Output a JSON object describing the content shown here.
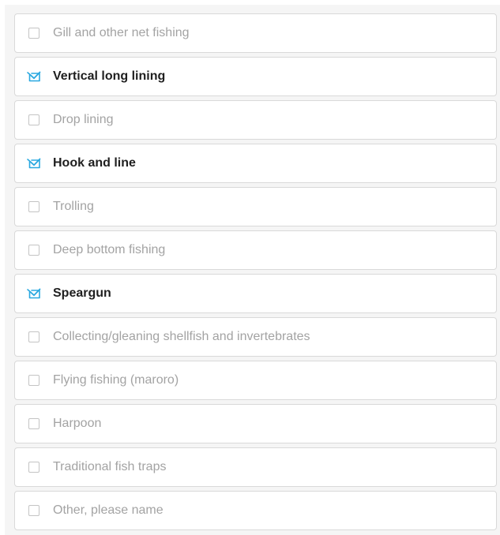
{
  "question": {
    "options": [
      {
        "label": "Gill and other net fishing",
        "checked": false
      },
      {
        "label": "Vertical long lining",
        "checked": true
      },
      {
        "label": "Drop lining",
        "checked": false
      },
      {
        "label": "Hook and line",
        "checked": true
      },
      {
        "label": "Trolling",
        "checked": false
      },
      {
        "label": "Deep bottom fishing",
        "checked": false
      },
      {
        "label": "Speargun",
        "checked": true
      },
      {
        "label": "Collecting/gleaning shellfish and invertebrates",
        "checked": false
      },
      {
        "label": "Flying fishing (maroro)",
        "checked": false
      },
      {
        "label": "Harpoon",
        "checked": false
      },
      {
        "label": "Traditional fish traps",
        "checked": false
      },
      {
        "label": "Other, please name",
        "checked": false
      }
    ]
  },
  "colors": {
    "accent": "#29a8e0",
    "checked_text": "#1f1f1f",
    "unchecked_text": "#a3a3a3",
    "border": "#d9d9d9"
  },
  "icons": {
    "checked": "checkmark-box-icon",
    "unchecked": "empty-checkbox-icon"
  }
}
